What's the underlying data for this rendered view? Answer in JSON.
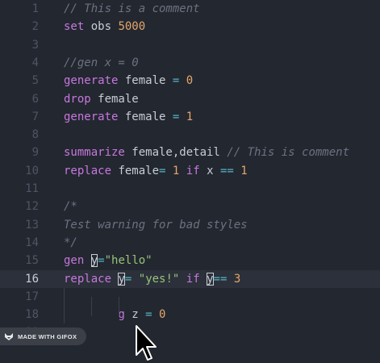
{
  "editor": {
    "active_line": 16,
    "lines": [
      {
        "n": "1",
        "tokens": [
          {
            "t": "// This is a comment",
            "c": "cm"
          }
        ]
      },
      {
        "n": "2",
        "tokens": [
          {
            "t": "set",
            "c": "kw"
          },
          {
            "t": " obs ",
            "c": "id"
          },
          {
            "t": "5000",
            "c": "num"
          }
        ]
      },
      {
        "n": "3",
        "tokens": []
      },
      {
        "n": "4",
        "tokens": [
          {
            "t": "//gen x = 0",
            "c": "cm"
          }
        ]
      },
      {
        "n": "5",
        "tokens": [
          {
            "t": "generate",
            "c": "kw"
          },
          {
            "t": " female ",
            "c": "id"
          },
          {
            "t": "=",
            "c": "op"
          },
          {
            "t": " ",
            "c": "id"
          },
          {
            "t": "0",
            "c": "num"
          }
        ]
      },
      {
        "n": "6",
        "tokens": [
          {
            "t": "drop",
            "c": "kw"
          },
          {
            "t": " female",
            "c": "id"
          }
        ]
      },
      {
        "n": "7",
        "tokens": [
          {
            "t": "generate",
            "c": "kw"
          },
          {
            "t": " female ",
            "c": "id"
          },
          {
            "t": "=",
            "c": "op"
          },
          {
            "t": " ",
            "c": "id"
          },
          {
            "t": "1",
            "c": "num"
          }
        ]
      },
      {
        "n": "8",
        "tokens": []
      },
      {
        "n": "9",
        "tokens": [
          {
            "t": "summarize",
            "c": "kw"
          },
          {
            "t": " female,detail ",
            "c": "id"
          },
          {
            "t": "// This is comment",
            "c": "cm"
          }
        ]
      },
      {
        "n": "10",
        "tokens": [
          {
            "t": "replace",
            "c": "kw"
          },
          {
            "t": " female",
            "c": "id"
          },
          {
            "t": "=",
            "c": "op"
          },
          {
            "t": " ",
            "c": "id"
          },
          {
            "t": "1",
            "c": "num"
          },
          {
            "t": " ",
            "c": "id"
          },
          {
            "t": "if",
            "c": "kw"
          },
          {
            "t": " x ",
            "c": "id"
          },
          {
            "t": "==",
            "c": "op"
          },
          {
            "t": " ",
            "c": "id"
          },
          {
            "t": "1",
            "c": "num"
          }
        ]
      },
      {
        "n": "11",
        "tokens": []
      },
      {
        "n": "12",
        "tokens": [
          {
            "t": "/*",
            "c": "cm"
          }
        ]
      },
      {
        "n": "13",
        "tokens": [
          {
            "t": "Test warning for bad styles",
            "c": "cm"
          }
        ]
      },
      {
        "n": "14",
        "tokens": [
          {
            "t": "*/",
            "c": "cm"
          }
        ]
      },
      {
        "n": "15",
        "tokens": [
          {
            "t": "gen",
            "c": "kw"
          },
          {
            "t": " ",
            "c": "id"
          },
          {
            "t": "y",
            "c": "id",
            "box": true
          },
          {
            "t": "=",
            "c": "op"
          },
          {
            "t": "\"hello\"",
            "c": "str"
          }
        ]
      },
      {
        "n": "16",
        "tokens": [
          {
            "t": "replace",
            "c": "kw"
          },
          {
            "t": " ",
            "c": "id"
          },
          {
            "t": "y",
            "c": "id",
            "box": true
          },
          {
            "t": "=",
            "c": "op"
          },
          {
            "t": " ",
            "c": "id"
          },
          {
            "t": "\"yes!\"",
            "c": "str"
          },
          {
            "t": " ",
            "c": "id"
          },
          {
            "t": "if",
            "c": "kw"
          },
          {
            "t": " ",
            "c": "id"
          },
          {
            "t": "y",
            "c": "id",
            "box": true
          },
          {
            "t": "==",
            "c": "op"
          },
          {
            "t": " ",
            "c": "id"
          },
          {
            "t": "3",
            "c": "num"
          }
        ]
      },
      {
        "n": "17",
        "tokens": []
      },
      {
        "n": "18",
        "tokens": [
          {
            "t": "        g",
            "c": "kw"
          },
          {
            "t": " z ",
            "c": "id"
          },
          {
            "t": "=",
            "c": "op"
          },
          {
            "t": " ",
            "c": "id"
          },
          {
            "t": "0",
            "c": "num"
          }
        ]
      },
      {
        "n": "19",
        "tokens": []
      }
    ]
  },
  "watermark": {
    "label": "MADE WITH GIFOX",
    "icon": "fox-icon"
  },
  "colors": {
    "background": "#232730",
    "active_line": "#2b303a",
    "keyword": "#c678dd",
    "number": "#e5a66b",
    "operator": "#56b6c2",
    "string": "#98c379",
    "comment": "#6b7280"
  }
}
